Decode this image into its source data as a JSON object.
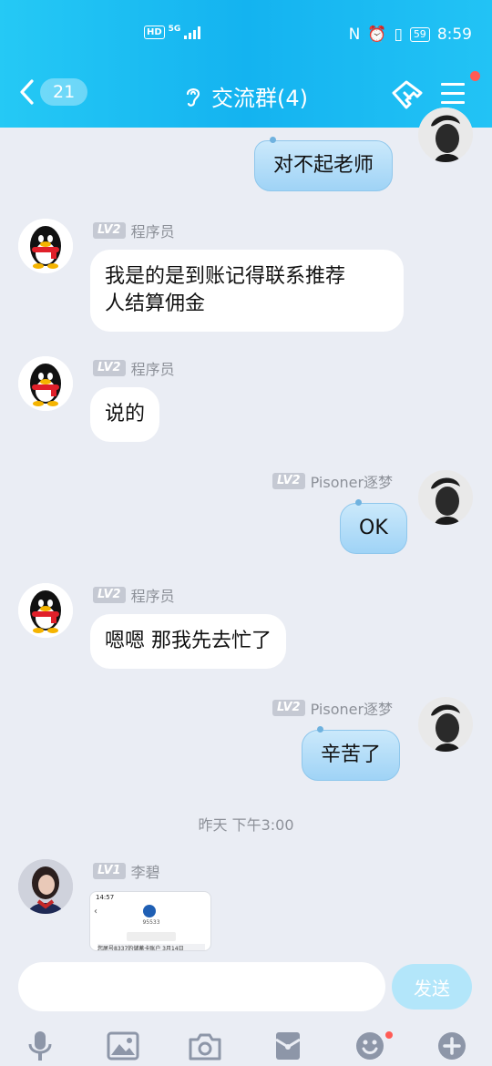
{
  "status_bar": {
    "network": "5G",
    "hd": "HD",
    "battery": "59",
    "time": "8:59"
  },
  "header": {
    "unread_count": "21",
    "title": "交流群(4)"
  },
  "messages": [
    {
      "sender": "",
      "level": "",
      "text": "对不起老师"
    },
    {
      "sender": "程序员",
      "level": "LV2",
      "text_line1": "我是的是到账记得联系推荐",
      "text_line2": "人结算佣金"
    },
    {
      "sender": "程序员",
      "level": "LV2",
      "text": "说的"
    },
    {
      "sender": "Pisoner逐梦",
      "level": "LV2",
      "text": "OK"
    },
    {
      "sender": "程序员",
      "level": "LV2",
      "text": "嗯嗯 那我先去忙了"
    },
    {
      "sender": "Pisoner逐梦",
      "level": "LV2",
      "text": "辛苦了"
    },
    {
      "sender": "李碧",
      "level": "LV1",
      "image_time": "14:57",
      "image_code": "95533",
      "image_caption": "您尾号8337的储蓄卡账户 3月14日"
    }
  ],
  "timestamp": "昨天 下午3:00",
  "input": {
    "placeholder": "",
    "send_label": "发送"
  },
  "toolbar_icons": [
    "mic-icon",
    "image-icon",
    "camera-icon",
    "red-packet-icon",
    "emoji-icon",
    "plus-icon"
  ]
}
